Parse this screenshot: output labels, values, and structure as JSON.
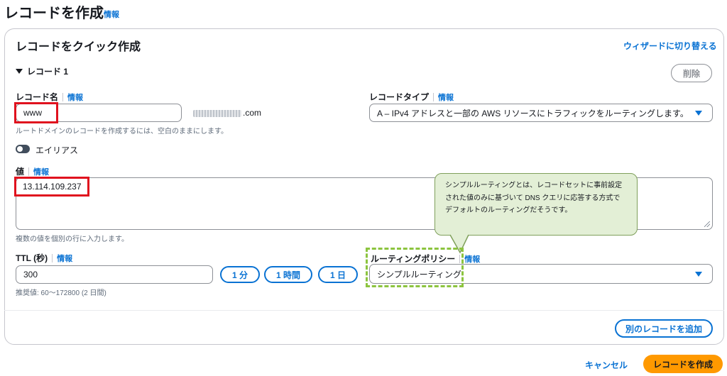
{
  "page": {
    "title": "レコードを作成",
    "info": "情報"
  },
  "card": {
    "title": "レコードをクイック作成",
    "wizard_link": "ウィザードに切り替える",
    "record_header": "レコード 1",
    "delete_label": "削除"
  },
  "record_name": {
    "label": "レコード名",
    "info": "情報",
    "value": "www",
    "domain_suffix": ".com",
    "hint": "ルートドメインのレコードを作成するには、空白のままにします。"
  },
  "record_type": {
    "label": "レコードタイプ",
    "info": "情報",
    "value": "A – IPv4 アドレスと一部の AWS リソースにトラフィックをルーティングします。"
  },
  "alias": {
    "label": "エイリアス",
    "enabled": false
  },
  "value_field": {
    "label": "値",
    "info": "情報",
    "value": "13.114.109.237",
    "hint": "複数の値を個別の行に入力します。"
  },
  "ttl": {
    "label": "TTL (秒)",
    "info": "情報",
    "value": "300",
    "hint": "推奨値: 60〜172800 (2 日間)",
    "presets": [
      "1 分",
      "1 時間",
      "1 日"
    ]
  },
  "routing_policy": {
    "label": "ルーティングポリシー",
    "info": "情報",
    "value": "シンプルルーティング"
  },
  "callout": {
    "text": "シンプルルーティングとは、レコードセットに事前設定された値のみに基づいて DNS クエリに応答する方式でデフォルトのルーティングだそうです。"
  },
  "add_record_label": "別のレコードを追加",
  "footer": {
    "cancel_label": "キャンセル",
    "create_label": "レコードを作成"
  },
  "colors": {
    "link": "#0972d3",
    "primary_button": "#ff9900",
    "highlight_red": "#e0121e",
    "highlight_green": "#8cc43f",
    "callout_bg": "#e3efd6"
  }
}
